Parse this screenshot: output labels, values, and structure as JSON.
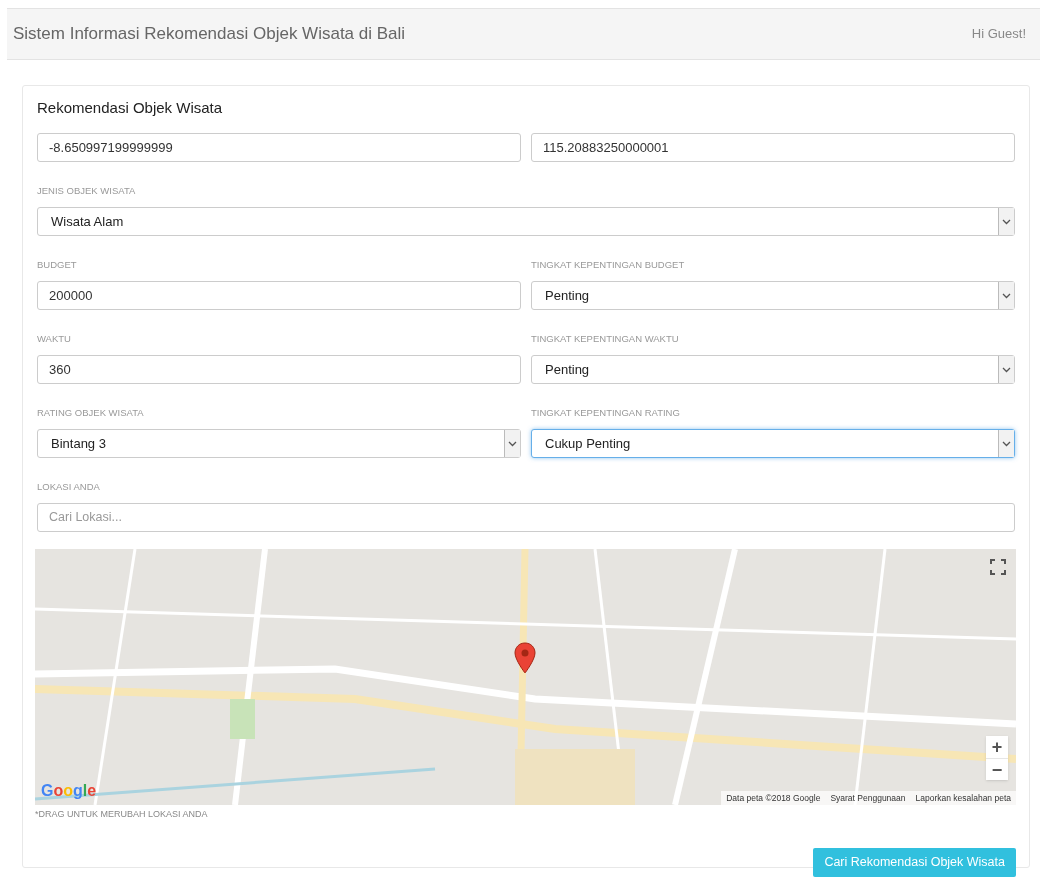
{
  "header": {
    "title": "Sistem Informasi Rekomendasi Objek Wisata di Bali",
    "greeting": "Hi Guest!"
  },
  "card": {
    "title": "Rekomendasi Objek Wisata",
    "rows": [
      [
        {
          "kind": "input",
          "value": "-8.650997199999999",
          "focused": false
        },
        {
          "kind": "input",
          "value": "115.20883250000001",
          "focused": false
        }
      ],
      [
        {
          "kind": "select",
          "label": "JENIS OBJEK WISATA",
          "value": "Wisata Alam",
          "focused": false
        }
      ],
      [
        {
          "kind": "input",
          "label": "BUDGET",
          "value": "200000",
          "focused": false
        },
        {
          "kind": "select",
          "label": "TINGKAT KEPENTINGAN BUDGET",
          "value": "Penting",
          "focused": false
        }
      ],
      [
        {
          "kind": "input",
          "label": "WAKTU",
          "value": "360",
          "focused": false
        },
        {
          "kind": "select",
          "label": "TINGKAT KEPENTINGAN WAKTU",
          "value": "Penting",
          "focused": false
        }
      ],
      [
        {
          "kind": "select",
          "label": "RATING OBJEK WISATA",
          "value": "Bintang 3",
          "focused": false
        },
        {
          "kind": "select",
          "label": "TINGKAT KEPENTINGAN RATING",
          "value": "Cukup Penting",
          "focused": true
        }
      ],
      [
        {
          "kind": "search",
          "label": "LOKASI ANDA",
          "placeholder": "Cari Lokasi...",
          "focused": false
        }
      ]
    ],
    "map": {
      "kind": "picture",
      "logo": "Google",
      "zoom_in": "+",
      "zoom_out": "−",
      "attribution": [
        "Data peta ©2018 Google",
        "Syarat Penggunaan",
        "Laporkan kesalahan peta"
      ]
    },
    "hint": "*DRAG UNTUK MERUBAH LOKASI ANDA",
    "submit": "Cari Rekomendasi Objek Wisata"
  }
}
